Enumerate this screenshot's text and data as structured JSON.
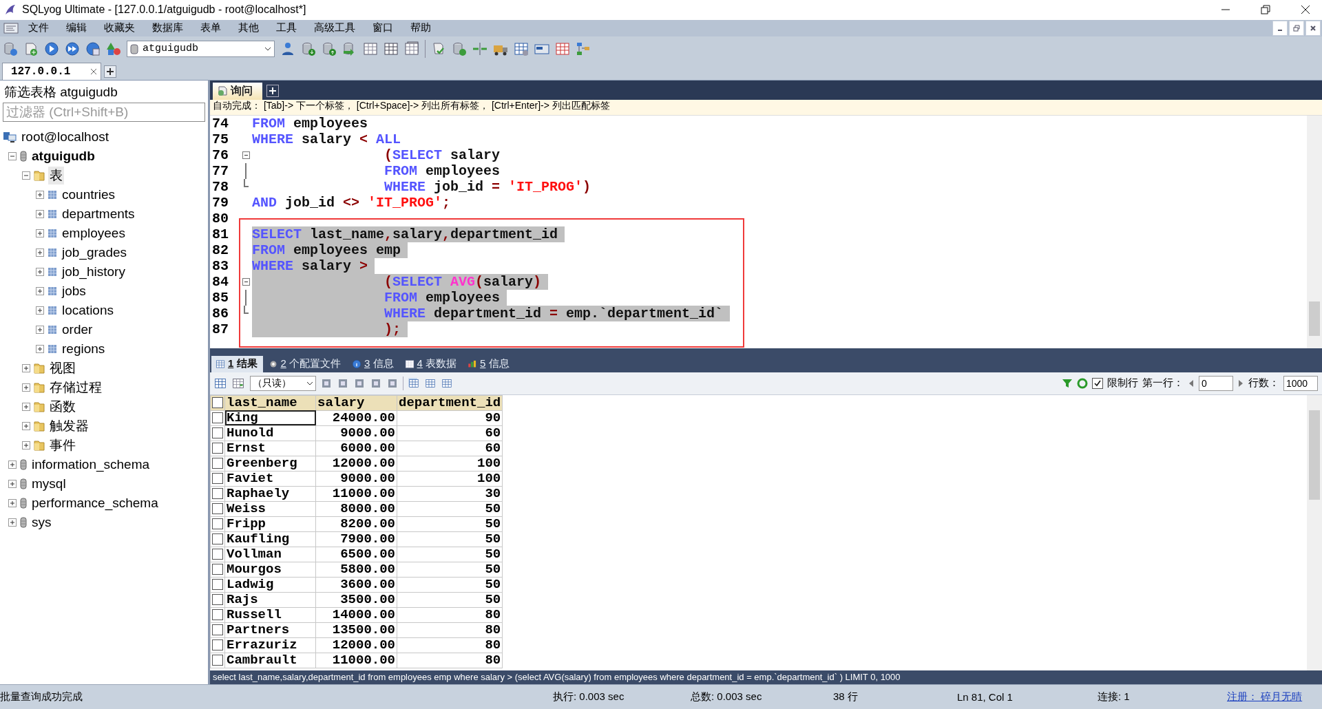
{
  "window": {
    "title": "SQLyog Ultimate - [127.0.0.1/atguigudb - root@localhost*]"
  },
  "menu": [
    "文件",
    "编辑",
    "收藏夹",
    "数据库",
    "表单",
    "其他",
    "工具",
    "高级工具",
    "窗口",
    "帮助"
  ],
  "toolbar": {
    "database": "atguigudb"
  },
  "connection_tabs": [
    {
      "label": "127.0.0.1",
      "selected": true
    }
  ],
  "object_browser": {
    "title": "筛选表格 atguigudb",
    "filter": {
      "placeholder": "过滤器 (Ctrl+Shift+B)"
    },
    "tree": [
      {
        "label": "root@localhost",
        "kind": "server",
        "selected": false,
        "children": [
          {
            "label": "atguigudb",
            "kind": "database",
            "active": true,
            "expanded": true,
            "selected": false,
            "children": [
              {
                "label": "表",
                "kind": "folder",
                "expanded": true,
                "selected": true,
                "children": [
                  {
                    "label": "countries",
                    "kind": "table",
                    "expanded": false,
                    "selected": false
                  },
                  {
                    "label": "departments",
                    "kind": "table",
                    "expanded": false,
                    "selected": false
                  },
                  {
                    "label": "employees",
                    "kind": "table",
                    "expanded": false,
                    "selected": false
                  },
                  {
                    "label": "job_grades",
                    "kind": "table",
                    "expanded": false,
                    "selected": false
                  },
                  {
                    "label": "job_history",
                    "kind": "table",
                    "expanded": false,
                    "selected": false
                  },
                  {
                    "label": "jobs",
                    "kind": "table",
                    "expanded": false,
                    "selected": false
                  },
                  {
                    "label": "locations",
                    "kind": "table",
                    "expanded": false,
                    "selected": false
                  },
                  {
                    "label": "order",
                    "kind": "table",
                    "expanded": false,
                    "selected": false
                  },
                  {
                    "label": "regions",
                    "kind": "table",
                    "expanded": false,
                    "selected": false
                  }
                ]
              },
              {
                "label": "视图",
                "kind": "folder",
                "expanded": false,
                "selected": false
              },
              {
                "label": "存储过程",
                "kind": "folder",
                "expanded": false,
                "selected": false
              },
              {
                "label": "函数",
                "kind": "folder",
                "expanded": false,
                "selected": false
              },
              {
                "label": "触发器",
                "kind": "folder",
                "expanded": false,
                "selected": false
              },
              {
                "label": "事件",
                "kind": "folder",
                "expanded": false,
                "selected": false
              }
            ]
          },
          {
            "label": "information_schema",
            "kind": "database",
            "active": false,
            "expanded": false,
            "selected": false
          },
          {
            "label": "mysql",
            "kind": "database",
            "active": false,
            "expanded": false,
            "selected": false
          },
          {
            "label": "performance_schema",
            "kind": "database",
            "active": false,
            "expanded": false,
            "selected": false
          },
          {
            "label": "sys",
            "kind": "database",
            "active": false,
            "expanded": false,
            "selected": false
          }
        ]
      }
    ]
  },
  "query_tabs": [
    {
      "label": "询问",
      "selected": true
    }
  ],
  "editor": {
    "hint": "自动完成： [Tab]-> 下一个标签， [Ctrl+Space]-> 列出所有标签， [Ctrl+Enter]-> 列出匹配标签",
    "lines": [
      {
        "number": "74",
        "kind": "plain",
        "indented": false,
        "selected": false,
        "tokens": [
          {
            "kind": "keyword",
            "text": "FROM"
          },
          {
            "kind": "ident",
            "text": " employees"
          }
        ]
      },
      {
        "number": "75",
        "kind": "plain",
        "indented": false,
        "selected": false,
        "tokens": [
          {
            "kind": "keyword",
            "text": "WHERE"
          },
          {
            "kind": "ident",
            "text": " salary "
          },
          {
            "kind": "op",
            "text": "<"
          },
          {
            "kind": "keyword",
            "text": " ALL"
          }
        ]
      },
      {
        "number": "76",
        "kind": "fold_start",
        "indented": true,
        "selected": false,
        "tokens": [
          {
            "kind": "op",
            "text": "("
          },
          {
            "kind": "keyword",
            "text": "SELECT"
          },
          {
            "kind": "ident",
            "text": " salary"
          }
        ]
      },
      {
        "number": "77",
        "kind": "fold_body",
        "indented": true,
        "selected": false,
        "tokens": [
          {
            "kind": "keyword",
            "text": "FROM"
          },
          {
            "kind": "ident",
            "text": " employees"
          }
        ]
      },
      {
        "number": "78",
        "kind": "fold_end",
        "indented": true,
        "selected": false,
        "tokens": [
          {
            "kind": "keyword",
            "text": "WHERE"
          },
          {
            "kind": "ident",
            "text": " job_id "
          },
          {
            "kind": "op",
            "text": "="
          },
          {
            "kind": "string",
            "text": " 'IT_PROG'"
          },
          {
            "kind": "op",
            "text": ")"
          }
        ]
      },
      {
        "number": "79",
        "kind": "plain",
        "indented": false,
        "selected": false,
        "tokens": [
          {
            "kind": "keyword",
            "text": "AND"
          },
          {
            "kind": "ident",
            "text": " job_id "
          },
          {
            "kind": "op",
            "text": "<>"
          },
          {
            "kind": "string",
            "text": " 'IT_PROG'"
          },
          {
            "kind": "op",
            "text": ";"
          }
        ]
      },
      {
        "number": "80",
        "kind": "plain"
      }
    ],
    "framed_lines": [
      {
        "number": "81",
        "kind": "plain",
        "indented": false,
        "selected": true,
        "tokens": [
          {
            "kind": "keyword",
            "text": "SELECT"
          },
          {
            "kind": "ident",
            "text": " last_name"
          },
          {
            "kind": "op",
            "text": ","
          },
          {
            "kind": "ident",
            "text": "salary"
          },
          {
            "kind": "op",
            "text": ","
          },
          {
            "kind": "ident",
            "text": "department_id"
          }
        ]
      },
      {
        "number": "82",
        "kind": "plain",
        "indented": false,
        "selected": true,
        "tokens": [
          {
            "kind": "keyword",
            "text": "FROM"
          },
          {
            "kind": "ident",
            "text": " employees emp"
          }
        ]
      },
      {
        "number": "83",
        "kind": "plain",
        "indented": false,
        "selected": true,
        "tokens": [
          {
            "kind": "keyword",
            "text": "WHERE"
          },
          {
            "kind": "ident",
            "text": " salary "
          },
          {
            "kind": "op",
            "text": ">"
          }
        ]
      },
      {
        "number": "84",
        "kind": "fold_start",
        "indented": true,
        "selected": true,
        "tokens": [
          {
            "kind": "op",
            "text": "("
          },
          {
            "kind": "keyword",
            "text": "SELECT "
          },
          {
            "kind": "function",
            "text": "AVG"
          },
          {
            "kind": "op",
            "text": "("
          },
          {
            "kind": "ident",
            "text": "salary"
          },
          {
            "kind": "op",
            "text": ")"
          }
        ]
      },
      {
        "number": "85",
        "kind": "fold_body",
        "indented": true,
        "selected": true,
        "tokens": [
          {
            "kind": "keyword",
            "text": "FROM"
          },
          {
            "kind": "ident",
            "text": " employees"
          }
        ]
      },
      {
        "number": "86",
        "kind": "fold_end",
        "indented": true,
        "selected": true,
        "tokens": [
          {
            "kind": "keyword",
            "text": "WHERE"
          },
          {
            "kind": "ident",
            "text": " department_id "
          },
          {
            "kind": "op",
            "text": "="
          },
          {
            "kind": "ident",
            "text": " emp.`department_id`"
          }
        ]
      },
      {
        "number": "87",
        "kind": "plain",
        "indented": true,
        "selected": true,
        "tokens": [
          {
            "kind": "op",
            "text": ");"
          }
        ]
      }
    ]
  },
  "result_tabs": [
    {
      "number": "1",
      "label": "结果",
      "selected": true
    },
    {
      "number": "2",
      "label": "个配置文件",
      "selected": false
    },
    {
      "number": "3",
      "label": "信息",
      "selected": false
    },
    {
      "number": "4",
      "label": "表数据",
      "selected": false
    },
    {
      "number": "5",
      "label": "信息",
      "selected": false
    }
  ],
  "results_toolbar": {
    "mode": "（只读）",
    "limit_label": "限制行",
    "limit_checked": true,
    "first_row_label": "第一行：",
    "first_row": "0",
    "rows_label": "行数：",
    "row_count": "1000"
  },
  "grid": {
    "all_checked": false,
    "columns": [
      "last_name",
      "salary",
      "department_id"
    ],
    "rows": [
      {
        "checked": false,
        "current": true,
        "cells": [
          "King",
          "24000.00",
          "90"
        ]
      },
      {
        "checked": false,
        "current": false,
        "cells": [
          "Hunold",
          "9000.00",
          "60"
        ]
      },
      {
        "checked": false,
        "current": false,
        "cells": [
          "Ernst",
          "6000.00",
          "60"
        ]
      },
      {
        "checked": false,
        "current": false,
        "cells": [
          "Greenberg",
          "12000.00",
          "100"
        ]
      },
      {
        "checked": false,
        "current": false,
        "cells": [
          "Faviet",
          "9000.00",
          "100"
        ]
      },
      {
        "checked": false,
        "current": false,
        "cells": [
          "Raphaely",
          "11000.00",
          "30"
        ]
      },
      {
        "checked": false,
        "current": false,
        "cells": [
          "Weiss",
          "8000.00",
          "50"
        ]
      },
      {
        "checked": false,
        "current": false,
        "cells": [
          "Fripp",
          "8200.00",
          "50"
        ]
      },
      {
        "checked": false,
        "current": false,
        "cells": [
          "Kaufling",
          "7900.00",
          "50"
        ]
      },
      {
        "checked": false,
        "current": false,
        "cells": [
          "Vollman",
          "6500.00",
          "50"
        ]
      },
      {
        "checked": false,
        "current": false,
        "cells": [
          "Mourgos",
          "5800.00",
          "50"
        ]
      },
      {
        "checked": false,
        "current": false,
        "cells": [
          "Ladwig",
          "3600.00",
          "50"
        ]
      },
      {
        "checked": false,
        "current": false,
        "cells": [
          "Rajs",
          "3500.00",
          "50"
        ]
      },
      {
        "checked": false,
        "current": false,
        "cells": [
          "Russell",
          "14000.00",
          "80"
        ]
      },
      {
        "checked": false,
        "current": false,
        "cells": [
          "Partners",
          "13500.00",
          "80"
        ]
      },
      {
        "checked": false,
        "current": false,
        "cells": [
          "Errazuriz",
          "12000.00",
          "80"
        ]
      },
      {
        "checked": false,
        "current": false,
        "cells": [
          "Cambrault",
          "11000.00",
          "80"
        ]
      }
    ]
  },
  "sql_line": "select last_name,salary,department_id from employees emp where salary > (select AVG(salary) from employees where department_id = emp.`department_id` ) LIMIT 0, 1000",
  "status_bar": {
    "message": "批量查询成功完成",
    "execution": "执行: 0.003 sec",
    "total": "总数: 0.003 sec",
    "rows": "38 行",
    "position": "Ln 81, Col 1",
    "connections": "连接: 1",
    "registration": "注册： 碎月无晴"
  }
}
